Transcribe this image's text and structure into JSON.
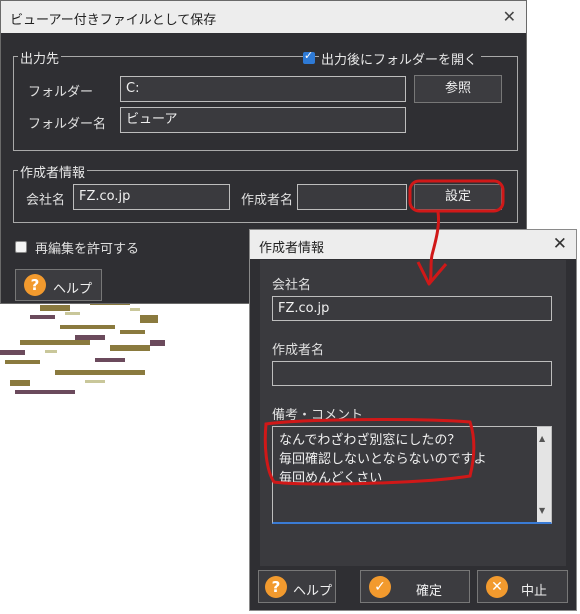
{
  "main_dialog": {
    "title": "ビューアー付きファイルとして保存",
    "output_group": {
      "legend": "出力先",
      "open_folder_checkbox": {
        "label": "出力後にフォルダーを開く",
        "checked": true
      },
      "folder_label": "フォルダー",
      "folder_value": "C:",
      "browse_button": "参照",
      "folder_name_label": "フォルダー名",
      "folder_name_value": "ビューア"
    },
    "author_group": {
      "legend": "作成者情報",
      "company_label": "会社名",
      "company_value": "FZ.co.jp",
      "author_label": "作成者名",
      "author_value": "",
      "settings_button": "設定"
    },
    "allow_edit_checkbox": {
      "label": "再編集を許可する",
      "checked": false
    },
    "help_button": "ヘルプ"
  },
  "author_dialog": {
    "title": "作成者情報",
    "company_label": "会社名",
    "company_value": "FZ.co.jp",
    "author_label": "作成者名",
    "author_value": "",
    "comment_label": "備考・コメント",
    "comment_lines": [
      "なんでわざわざ別窓にしたの？",
      "毎回確認しないとならないのですよ",
      "毎回めんどくさい"
    ],
    "help_button": "ヘルプ",
    "ok_button": "確定",
    "cancel_button": "中止"
  },
  "colors": {
    "dialog_bg": "#2f2f33",
    "titlebar_bg": "#ededed",
    "accent_icon": "#f29a2e",
    "annotation_red": "#d01818",
    "checkbox_blue": "#2e7ad6"
  }
}
